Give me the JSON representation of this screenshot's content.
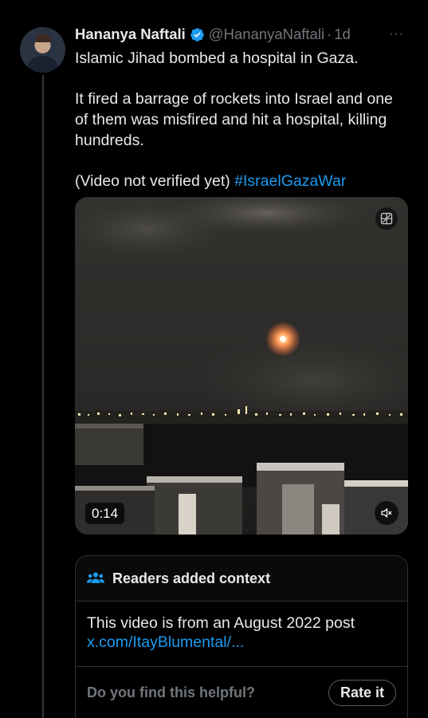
{
  "tweet": {
    "display_name": "Hananya Naftali",
    "handle": "@HananyaNaftali",
    "separator": "·",
    "time": "1d",
    "more_label": "···",
    "text_line1": "Islamic Jihad bombed a hospital in Gaza.",
    "text_para2": "It fired a barrage of rockets into Israel and one of them was misfired and hit a hospital, killing hundreds.",
    "text_para3_prefix": "(Video not verified yet)",
    "hashtag": "#IsraelGazaWar"
  },
  "video": {
    "duration": "0:14",
    "mute_icon": "speaker-muted-icon",
    "media_icon": "gif-grid-icon"
  },
  "community_note": {
    "title": "Readers added context",
    "icon": "people-icon",
    "body": "This video is from an August 2022 post",
    "link": "x.com/ItayBlumental/...",
    "question": "Do you find this helpful?",
    "rate_label": "Rate it"
  },
  "colors": {
    "background": "#000000",
    "text": "#e7e9ea",
    "muted": "#71767b",
    "accent": "#1d9bf0",
    "border": "#2f3336"
  }
}
